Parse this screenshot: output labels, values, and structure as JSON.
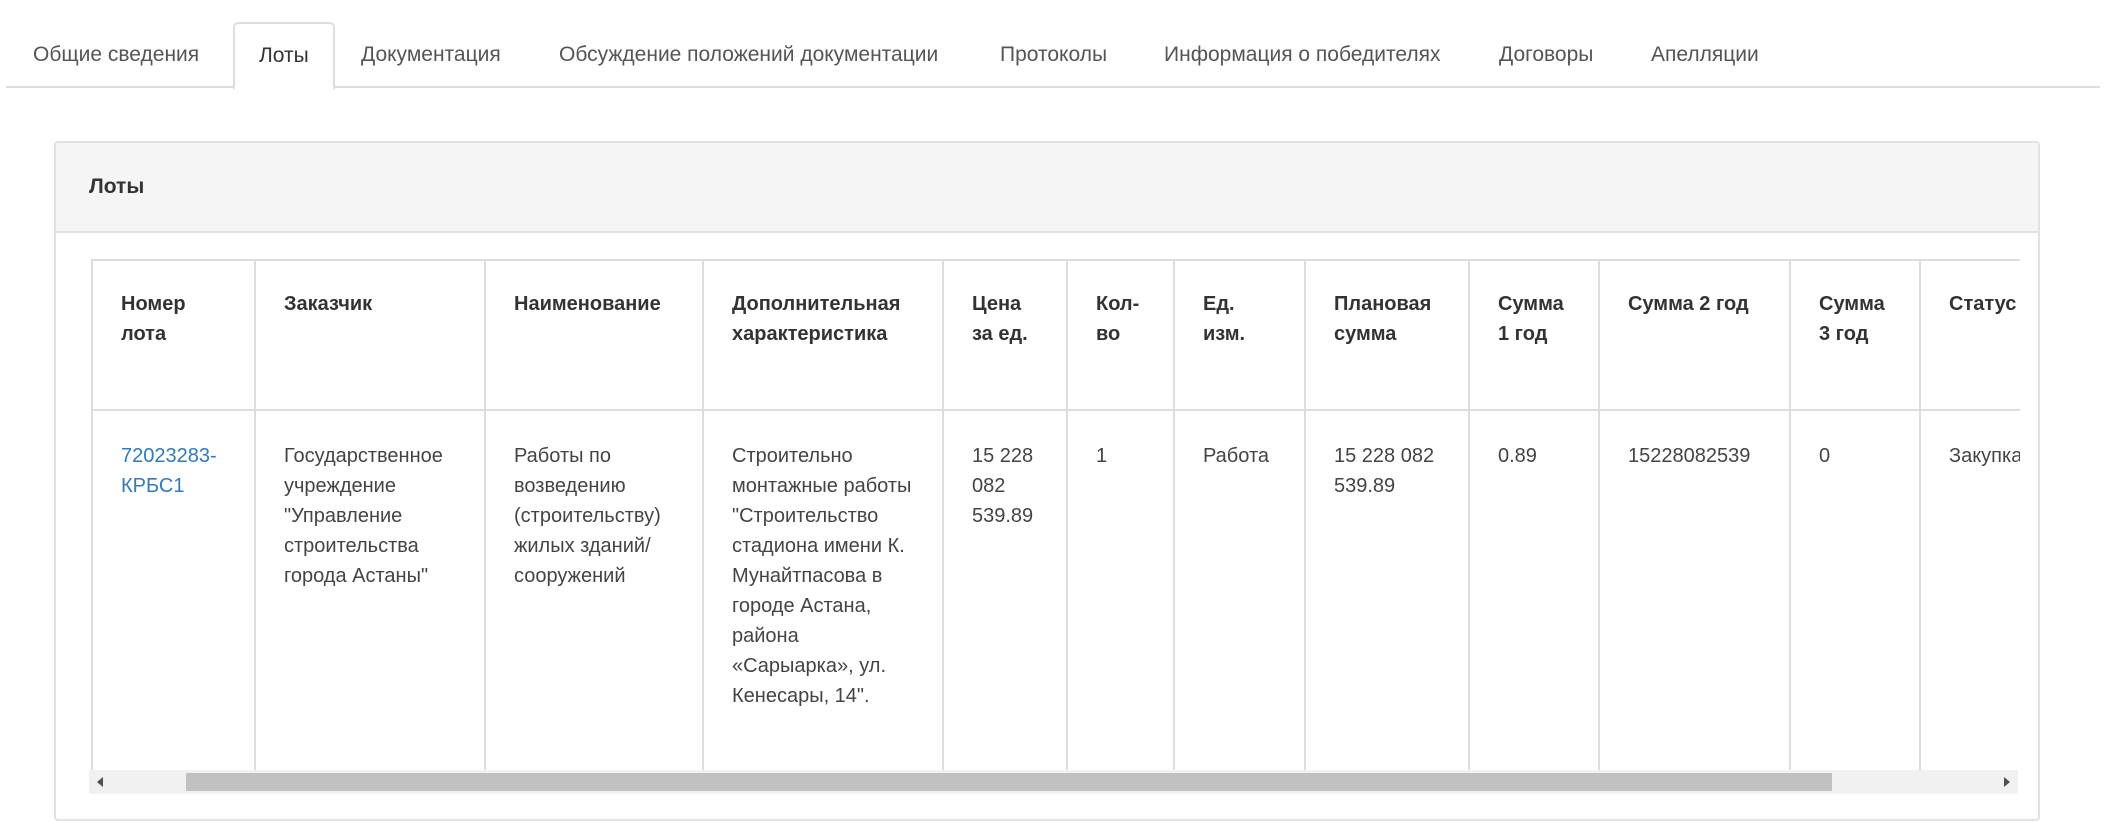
{
  "tabs": [
    {
      "label": "Общие сведения",
      "active": false
    },
    {
      "label": "Лоты",
      "active": true
    },
    {
      "label": "Документация",
      "active": false
    },
    {
      "label": "Обсуждение положений документации",
      "active": false
    },
    {
      "label": "Протоколы",
      "active": false
    },
    {
      "label": "Информация о победителях",
      "active": false
    },
    {
      "label": "Договоры",
      "active": false
    },
    {
      "label": "Апелляции",
      "active": false
    }
  ],
  "panel": {
    "title": "Лоты"
  },
  "table": {
    "headers": [
      "Номер лота",
      "Заказчик",
      "Наименование",
      "Дополнительная характеристика",
      "Цена за ед.",
      "Кол-во",
      "Ед. изм.",
      "Плановая сумма",
      "Сумма 1 год",
      "Сумма 2 год",
      "Сумма 3 год",
      "Статус лота"
    ],
    "rows": [
      {
        "lot_number": "72023283-КРБС1",
        "customer": "Государственное учреждение \"Управление строительства города Астаны\"",
        "name": "Работы по возведению (строительству) жилых зданий/ сооружений",
        "extra": "Строительно монтажные работы \"Строительство стадиона имени К. Мунайтпасова в городе Астана, района «Сарыарка», ул. Кенесары, 14\".",
        "unit_price": "15 228 082 539.89",
        "quantity": "1",
        "unit": "Работа",
        "planned_sum": "15 228 082 539.89",
        "sum_year1": "0.89",
        "sum_year2": "15228082539",
        "sum_year3": "0",
        "status": "Закупка состоялась"
      }
    ]
  },
  "colors": {
    "link": "#337ab7",
    "border": "#dddddd",
    "panel_heading_bg": "#f5f5f5"
  }
}
